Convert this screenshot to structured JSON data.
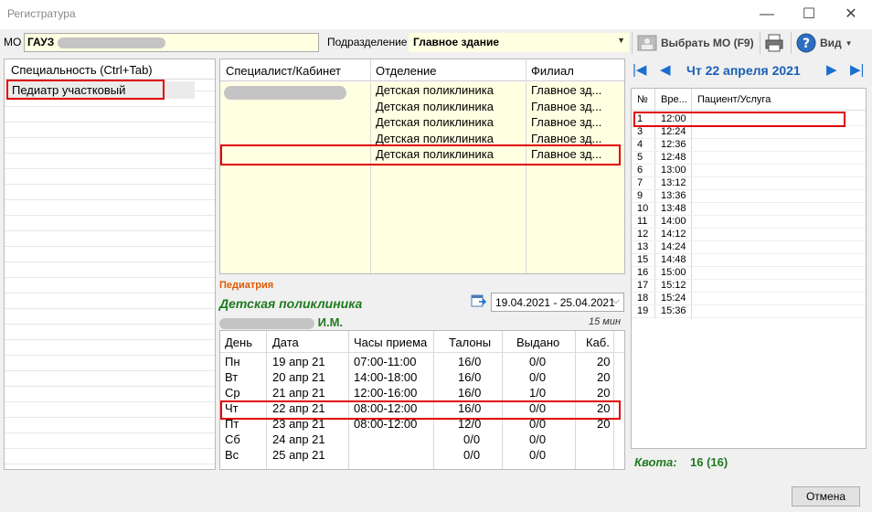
{
  "window": {
    "title": "Регистратура",
    "minimize": "—",
    "maximize": "☐",
    "close": "✕"
  },
  "toolbar": {
    "mo_label": "МО",
    "mo_value": "ГАУЗ",
    "sub_label": "Подразделение",
    "sub_value": "Главное здание",
    "select_mo_button": "Выбрать МО (F9)",
    "view_button": "Вид"
  },
  "specialties": {
    "header": "Специальность (Ctrl+Tab)",
    "selected": "Педиатр участковый"
  },
  "specialists": {
    "columns": [
      "Специалист/Кабинет",
      "Отделение",
      "Филиал"
    ],
    "rows": [
      {
        "department": "Детская поликлиника",
        "branch": "Главное зд..."
      },
      {
        "department": "Детская поликлиника",
        "branch": "Главное зд..."
      },
      {
        "department": "Детская поликлиника",
        "branch": "Главное зд..."
      },
      {
        "department": "Детская поликлиника",
        "branch": "Главное зд..."
      },
      {
        "department": "Детская поликлиника",
        "branch": "Главное зд..."
      }
    ]
  },
  "info": {
    "department_small": "Педиатрия",
    "department_big": "Детская поликлиника",
    "doctor_initials": "И.М.",
    "slot_length": "15 мин",
    "date_range": "19.04.2021 - 25.04.2021"
  },
  "schedule": {
    "columns": [
      "День",
      "Дата",
      "Часы приема",
      "Талоны",
      "Выдано",
      "Каб."
    ],
    "rows": [
      {
        "day": "Пн",
        "date": "19 апр 21",
        "hours": "07:00-11:00",
        "tickets": "16/0",
        "issued": "0/0",
        "room": "20"
      },
      {
        "day": "Вт",
        "date": "20 апр 21",
        "hours": "14:00-18:00",
        "tickets": "16/0",
        "issued": "0/0",
        "room": "20"
      },
      {
        "day": "Ср",
        "date": "21 апр 21",
        "hours": "12:00-16:00",
        "tickets": "16/0",
        "issued": "1/0",
        "room": "20"
      },
      {
        "day": "Чт",
        "date": "22 апр 21",
        "hours": "08:00-12:00",
        "tickets": "16/0",
        "issued": "0/0",
        "room": "20"
      },
      {
        "day": "Пт",
        "date": "23 апр 21",
        "hours": "08:00-12:00",
        "tickets": "12/0",
        "issued": "0/0",
        "room": "20"
      },
      {
        "day": "Сб",
        "date": "24 апр 21",
        "hours": "",
        "tickets": "0/0",
        "issued": "0/0",
        "room": ""
      },
      {
        "day": "Вс",
        "date": "25 апр 21",
        "hours": "",
        "tickets": "0/0",
        "issued": "0/0",
        "room": ""
      }
    ]
  },
  "calendar": {
    "date": "Чт 22 апреля 2021"
  },
  "slots": {
    "columns": [
      "№",
      "Вре...",
      "Пациент/Услуга"
    ],
    "rows": [
      {
        "n": "1",
        "t": "12:00"
      },
      {
        "n": "3",
        "t": "12:24"
      },
      {
        "n": "4",
        "t": "12:36"
      },
      {
        "n": "5",
        "t": "12:48"
      },
      {
        "n": "6",
        "t": "13:00"
      },
      {
        "n": "7",
        "t": "13:12"
      },
      {
        "n": "9",
        "t": "13:36"
      },
      {
        "n": "10",
        "t": "13:48"
      },
      {
        "n": "11",
        "t": "14:00"
      },
      {
        "n": "12",
        "t": "14:12"
      },
      {
        "n": "13",
        "t": "14:24"
      },
      {
        "n": "15",
        "t": "14:48"
      },
      {
        "n": "16",
        "t": "15:00"
      },
      {
        "n": "17",
        "t": "15:12"
      },
      {
        "n": "18",
        "t": "15:24"
      },
      {
        "n": "19",
        "t": "15:36"
      }
    ]
  },
  "quota": {
    "label": "Квота:",
    "value": "16 (16)"
  },
  "footer": {
    "cancel": "Отмена"
  },
  "colors": {
    "highlight": "#e00000",
    "accent_green": "#1f7a1f",
    "accent_orange": "#e05a00",
    "accent_blue": "#1a5fb4",
    "grid_yellow": "#ffffe1"
  }
}
